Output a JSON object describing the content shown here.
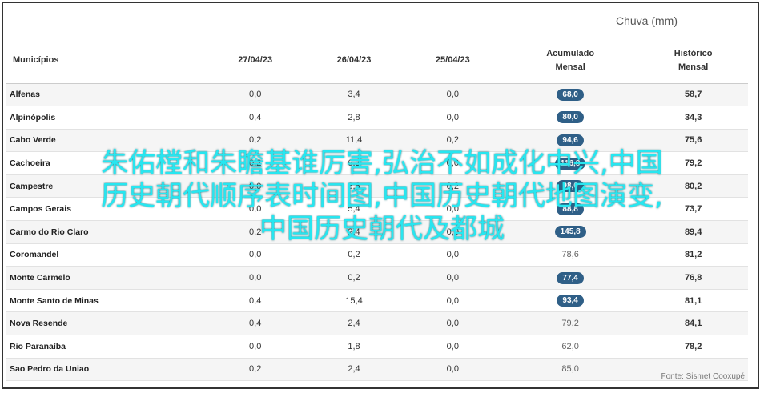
{
  "header": {
    "chuva_label": "Chuva (mm)"
  },
  "columns": {
    "municipios": "Municípios",
    "d1": "27/04/23",
    "d2": "26/04/23",
    "d3": "25/04/23",
    "acum_l1": "Acumulado",
    "acum_l2": "Mensal",
    "hist_l1": "Histórico",
    "hist_l2": "Mensal"
  },
  "rows": [
    {
      "name": "Alfenas",
      "d1": "0,0",
      "d2": "3,4",
      "d3": "0,0",
      "acum": "68,0",
      "badge": true,
      "hist": "58,7"
    },
    {
      "name": "Alpinópolis",
      "d1": "0,4",
      "d2": "2,8",
      "d3": "0,0",
      "acum": "80,0",
      "badge": true,
      "hist": "34,3"
    },
    {
      "name": "Cabo Verde",
      "d1": "0,2",
      "d2": "11,4",
      "d3": "0,2",
      "acum": "94,6",
      "badge": true,
      "hist": "75,6"
    },
    {
      "name": "Cachoeira",
      "d1": "0,2",
      "d2": "6,2",
      "d3": "0,0",
      "acum": "116,8",
      "badge": true,
      "hist": "79,2"
    },
    {
      "name": "Campestre",
      "d1": "0,0",
      "d2": "6,6",
      "d3": "0,2",
      "acum": "98,0",
      "badge": true,
      "hist": "80,2"
    },
    {
      "name": "Campos Gerais",
      "d1": "0,0",
      "d2": "5,4",
      "d3": "0,0",
      "acum": "88,8",
      "badge": true,
      "hist": "73,7"
    },
    {
      "name": "Carmo do Rio Claro",
      "d1": "0,2",
      "d2": "2,4",
      "d3": "0,0",
      "acum": "145,8",
      "badge": true,
      "hist": "89,4"
    },
    {
      "name": "Coromandel",
      "d1": "0,0",
      "d2": "0,2",
      "d3": "0,0",
      "acum": "78,6",
      "badge": false,
      "hist": "81,2"
    },
    {
      "name": "Monte Carmelo",
      "d1": "0,0",
      "d2": "0,2",
      "d3": "0,0",
      "acum": "77,4",
      "badge": true,
      "hist": "76,8"
    },
    {
      "name": "Monte Santo de Minas",
      "d1": "0,4",
      "d2": "15,4",
      "d3": "0,0",
      "acum": "93,4",
      "badge": true,
      "hist": "81,1"
    },
    {
      "name": "Nova Resende",
      "d1": "0,4",
      "d2": "2,4",
      "d3": "0,0",
      "acum": "79,2",
      "badge": false,
      "hist": "84,1"
    },
    {
      "name": "Rio Paranaíba",
      "d1": "0,0",
      "d2": "1,8",
      "d3": "0,0",
      "acum": "62,0",
      "badge": false,
      "hist": "78,2"
    },
    {
      "name": "Sao Pedro da Uniao",
      "d1": "0,2",
      "d2": "2,4",
      "d3": "0,0",
      "acum": "85,0",
      "badge": false,
      "hist": ""
    }
  ],
  "fonte": "Fonte: Sismet Cooxupé",
  "overlay": {
    "line1": "朱佑樘和朱瞻基谁厉害,弘治不如成化中兴,中国",
    "line2": "历史朝代顺序表时间图,中国历史朝代地图演变,",
    "line3": "中国历史朝代及都城"
  }
}
